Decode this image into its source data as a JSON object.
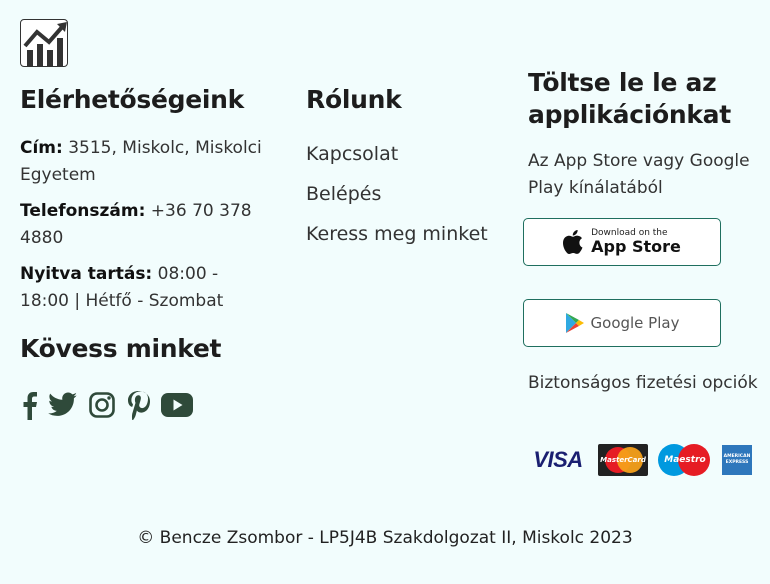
{
  "logo": {
    "icon": "chart-trend-icon"
  },
  "contact": {
    "title": "Elérhetőségeink",
    "address_label": "Cím:",
    "address_value": " 3515, Miskolc, Miskolci Egyetem",
    "phone_label": "Telefonszám:",
    "phone_value": " +36 70 378 4880",
    "hours_label": "Nyitva tartás:",
    "hours_value": " 08:00 - 18:00 | Hétfő - Szombat",
    "follow_title": "Kövess minket",
    "social": [
      "facebook-icon",
      "twitter-icon",
      "instagram-icon",
      "pinterest-icon",
      "youtube-icon"
    ]
  },
  "about": {
    "title": "Rólunk",
    "links": [
      "Kapcsolat",
      "Belépés",
      "Keress meg minket"
    ]
  },
  "app": {
    "title": "Töltse le le az applikációnkat",
    "description": "Az App Store vagy Google Play kínálatából",
    "appstore_small": "Download on the",
    "appstore_big": "App Store",
    "googleplay": "Google Play",
    "payment_text": "Biztonságos fizetési opciók",
    "cards": {
      "visa": "VISA",
      "mastercard": "MasterCard",
      "maestro": "Maestro",
      "amex_top": "AMERICAN",
      "amex_bottom": "EXPRESS"
    }
  },
  "footer": {
    "text": "© Bencze Zsombor - LP5J4B Szakdolgozat II, Miskolc 2023"
  },
  "colors": {
    "background": "#f2fdfd",
    "button_border": "#1f6f5f",
    "icon": "#2f4a3a"
  }
}
